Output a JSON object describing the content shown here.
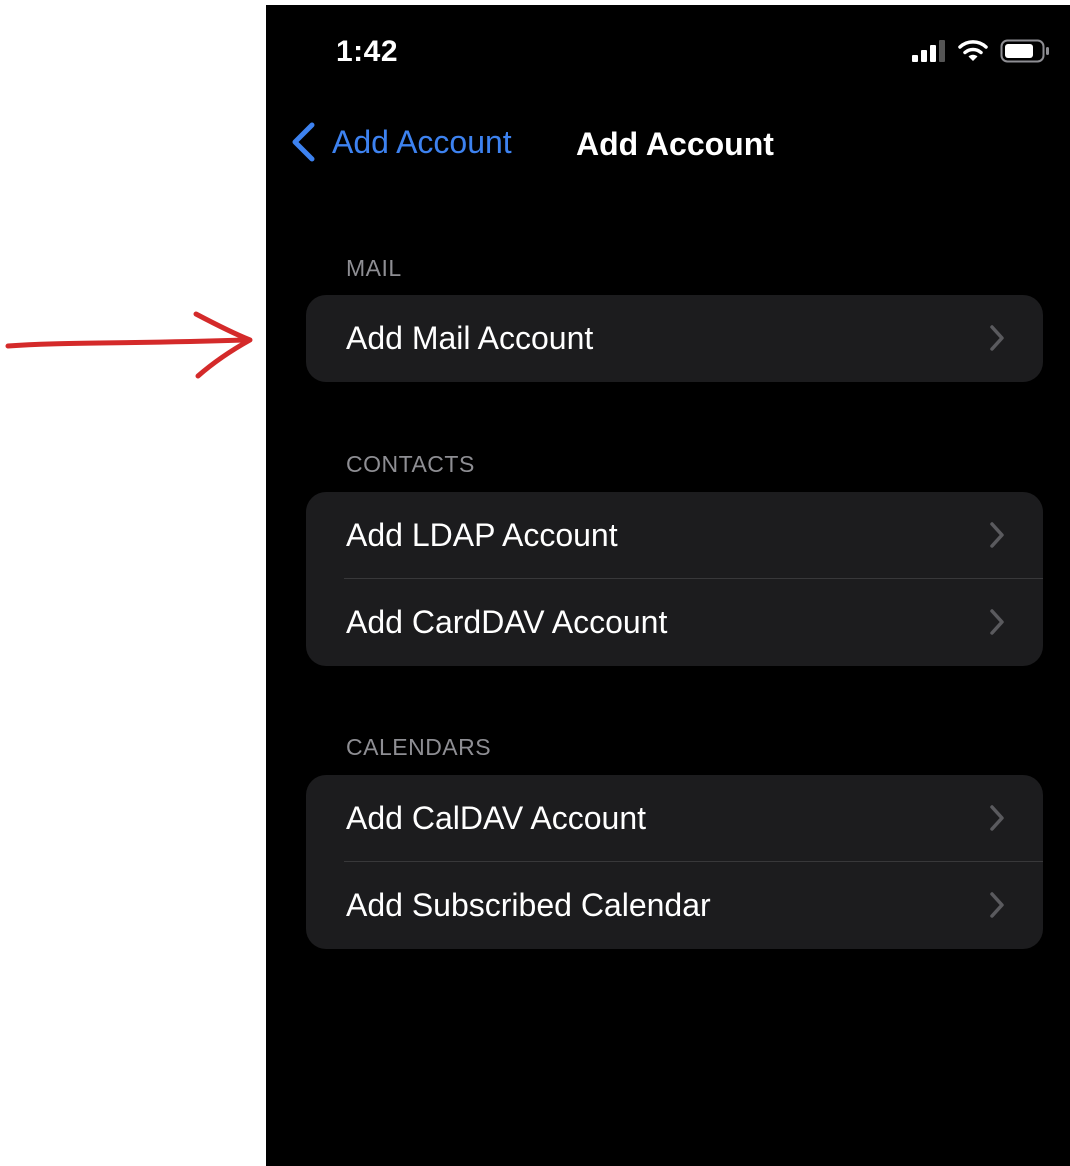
{
  "status_bar": {
    "time": "1:42",
    "icons": [
      "cellular-signal-icon",
      "wifi-icon",
      "battery-icon"
    ]
  },
  "nav": {
    "back_label": "Add Account",
    "title": "Add Account"
  },
  "sections": [
    {
      "header": "MAIL",
      "rows": [
        {
          "label": "Add Mail Account"
        }
      ]
    },
    {
      "header": "CONTACTS",
      "rows": [
        {
          "label": "Add LDAP Account"
        },
        {
          "label": "Add CardDAV Account"
        }
      ]
    },
    {
      "header": "CALENDARS",
      "rows": [
        {
          "label": "Add CalDAV Account"
        },
        {
          "label": "Add Subscribed Calendar"
        }
      ]
    }
  ],
  "annotation": {
    "type": "red-arrow-icon",
    "color": "#d42a2a",
    "points_to": "Add Mail Account"
  },
  "colors": {
    "background": "#000000",
    "cell": "#1c1c1e",
    "accent": "#3d82f0",
    "section_header": "#8e8e93",
    "chevron": "#5a5a5e",
    "separator": "#38383a"
  }
}
